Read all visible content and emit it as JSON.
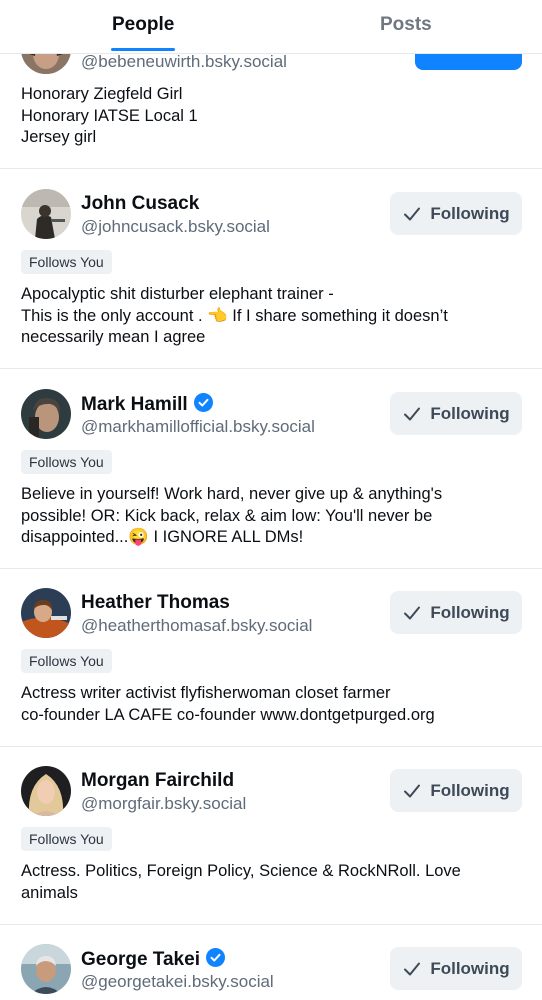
{
  "tabs": {
    "people": "People",
    "posts": "Posts"
  },
  "cards": [
    {
      "handle": "@bebeneuwirth.bsky.social",
      "bio": "Honorary Ziegfeld Girl\nHonorary IATSE Local 1\nJersey girl"
    },
    {
      "name": "John Cusack",
      "handle": "@johncusack.bsky.social",
      "button": "Following",
      "badge": "Follows You",
      "bio": "Apocalyptic shit disturber elephant trainer -\nThis is the only account . 👈 If I share something it doesn’t\nnecessarily mean I agree"
    },
    {
      "name": "Mark Hamill",
      "verified": true,
      "handle": "@markhamillofficial.bsky.social",
      "button": "Following",
      "badge": "Follows You",
      "bio": "Believe in yourself! Work hard, never give up & anything's\npossible! OR: Kick back, relax & aim low: You'll never be\ndisappointed...😜 I IGNORE ALL DMs!"
    },
    {
      "name": "Heather Thomas",
      "handle": "@heatherthomasaf.bsky.social",
      "button": "Following",
      "badge": "Follows You",
      "bio": "Actress writer activist  flyfisherwoman closet farmer\nco-founder LA CAFE co-founder www.dontgetpurged.org"
    },
    {
      "name": "Morgan Fairchild",
      "handle": "@morgfair.bsky.social",
      "button": "Following",
      "badge": "Follows You",
      "bio": "Actress. Politics, Foreign Policy, Science & RockNRoll. Love\nanimals"
    },
    {
      "name": "George Takei",
      "verified": true,
      "handle": "@georgetakei.bsky.social",
      "button": "Following"
    }
  ],
  "colors": {
    "accent": "#1083fe",
    "button_bg": "#eef1f4",
    "handle": "#5f6b79",
    "divider": "#e6e8eb"
  },
  "icons": {
    "verified": "verified-check-icon",
    "following": "check-icon"
  }
}
